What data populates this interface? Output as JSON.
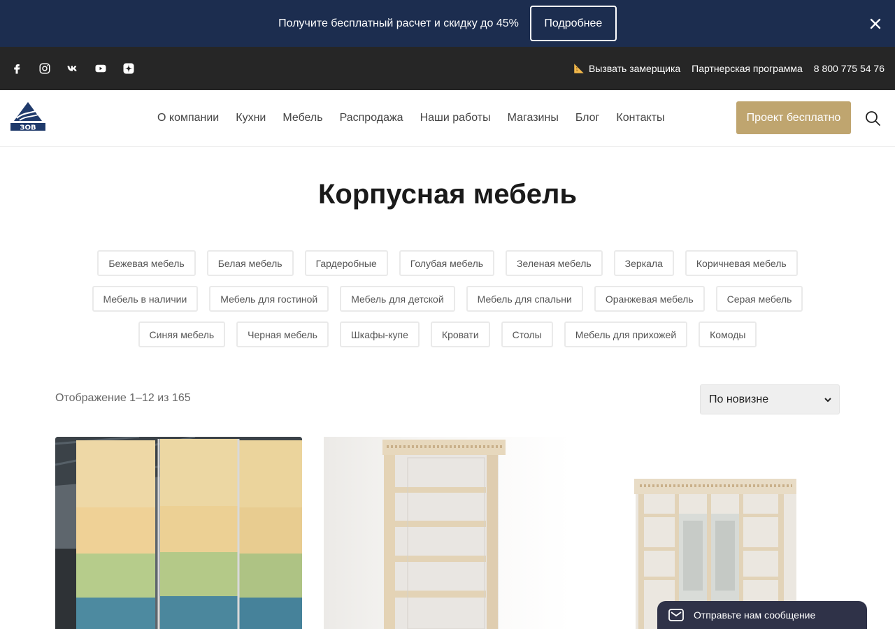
{
  "promo": {
    "text": "Получите бесплатный расчет и скидку до 45%",
    "button": "Подробнее"
  },
  "topbar": {
    "socials": [
      "facebook-icon",
      "instagram-icon",
      "vk-icon",
      "youtube-icon",
      "zen-icon"
    ],
    "links": {
      "measure": "Вызвать замерщика",
      "partner": "Партнерская программа",
      "phone": "8 800 775 54 76"
    }
  },
  "header": {
    "logo_text": "ЗОВ",
    "nav": [
      "О компании",
      "Кухни",
      "Мебель",
      "Распродажа",
      "Наши работы",
      "Магазины",
      "Блог",
      "Контакты"
    ],
    "cta": "Проект бесплатно"
  },
  "page": {
    "title": "Корпусная мебель",
    "tags": [
      [
        "Бежевая мебель",
        "Белая мебель",
        "Гардеробные",
        "Голубая мебель",
        "Зеленая мебель",
        "Зеркала",
        "Коричневая мебель"
      ],
      [
        "Мебель в наличии",
        "Мебель для гостиной",
        "Мебель для детской",
        "Мебель для спальни",
        "Оранжевая мебель",
        "Серая мебель"
      ],
      [
        "Синяя мебель",
        "Черная мебель",
        "Шкафы-купе",
        "Кровати",
        "Столы",
        "Мебель для прихожей",
        "Комоды"
      ]
    ],
    "results": "Отображение 1–12 из 165",
    "sort": "По новизне"
  },
  "chat": {
    "label": "Отправьте нам сообщение"
  },
  "colors": {
    "promo_bg": "#1c2d4f",
    "topbar_bg": "#262626",
    "accent": "#bfa56f",
    "chat_bg": "#2f3248"
  }
}
